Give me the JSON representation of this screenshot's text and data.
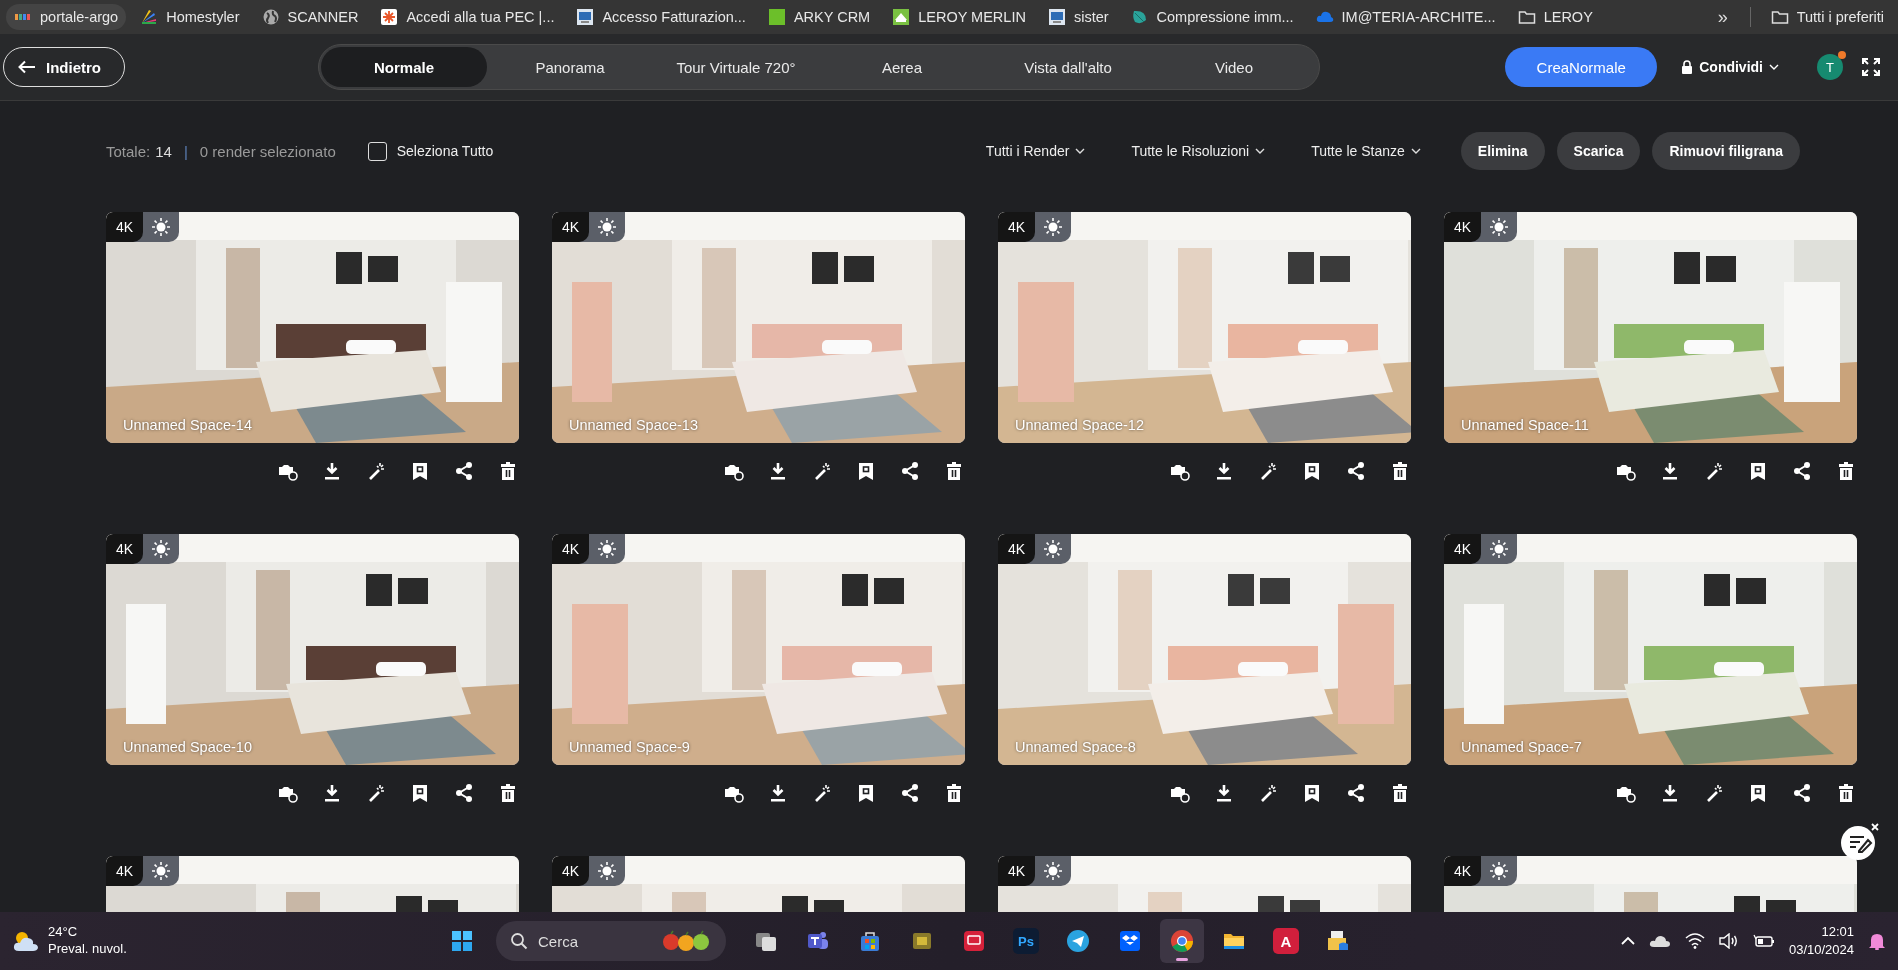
{
  "bookmarks": [
    {
      "label": "portale-argo",
      "kind": "bars"
    },
    {
      "label": "Homestyler",
      "kind": "fan"
    },
    {
      "label": "SCANNER",
      "kind": "globe"
    },
    {
      "label": "Accedi alla tua PEC |...",
      "kind": "star"
    },
    {
      "label": "Accesso Fatturazion...",
      "kind": "doc"
    },
    {
      "label": "ARKY CRM",
      "kind": "square"
    },
    {
      "label": "LEROY MERLIN",
      "kind": "house"
    },
    {
      "label": "sister",
      "kind": "doc"
    },
    {
      "label": "Compressione imm...",
      "kind": "leaf"
    },
    {
      "label": "IM@TERIA-ARCHITE...",
      "kind": "cloud"
    },
    {
      "label": "LEROY",
      "kind": "folder"
    }
  ],
  "bookmarks_more": "»",
  "all_bookmarks": "Tutti i preferiti",
  "header": {
    "back": "Indietro",
    "tabs": [
      {
        "label": "Normale",
        "selected": true
      },
      {
        "label": "Panorama",
        "selected": false
      },
      {
        "label": "Tour Virtuale 720°",
        "selected": false
      },
      {
        "label": "Aerea",
        "selected": false
      },
      {
        "label": "Vista dall'alto",
        "selected": false
      },
      {
        "label": "Video",
        "selected": false
      }
    ],
    "create": "CreaNormale",
    "share": "Condividi",
    "avatar": "T",
    "notification": true
  },
  "toolbar": {
    "total_label": "Totale:",
    "total": "14",
    "separator": "|",
    "selected_count": "0 render selezionato",
    "select_all": {
      "label": "Seleziona Tutto",
      "checked": false
    },
    "filters": [
      "Tutti i Render",
      "Tutte le Risoluzioni",
      "Tutte le Stanze"
    ],
    "actions": [
      "Elimina",
      "Scarica",
      "Rimuovi filigrana"
    ]
  },
  "renders": [
    {
      "resolution": "4K",
      "name": "Unnamed Space-14"
    },
    {
      "resolution": "4K",
      "name": "Unnamed Space-13"
    },
    {
      "resolution": "4K",
      "name": "Unnamed Space-12"
    },
    {
      "resolution": "4K",
      "name": "Unnamed Space-11"
    },
    {
      "resolution": "4K",
      "name": "Unnamed Space-10"
    },
    {
      "resolution": "4K",
      "name": "Unnamed Space-9"
    },
    {
      "resolution": "4K",
      "name": "Unnamed Space-8"
    },
    {
      "resolution": "4K",
      "name": "Unnamed Space-7"
    },
    {
      "resolution": "4K"
    },
    {
      "resolution": "4K"
    },
    {
      "resolution": "4K"
    },
    {
      "resolution": "4K"
    }
  ],
  "taskbar": {
    "weather": {
      "temp": "24°C",
      "desc": "Preval. nuvol."
    },
    "search": "Cerca",
    "apps": [
      {
        "kind": "windows",
        "active": false
      },
      {
        "kind": "tasks",
        "active": false
      },
      {
        "kind": "teams",
        "active": false
      },
      {
        "kind": "store",
        "active": false
      },
      {
        "kind": "card",
        "active": false
      },
      {
        "kind": "remote",
        "active": false
      },
      {
        "kind": "ps",
        "label": "Ps",
        "active": false
      },
      {
        "kind": "telegram",
        "active": false
      },
      {
        "kind": "dropbox",
        "active": false
      },
      {
        "kind": "chrome",
        "active": true
      },
      {
        "kind": "explorer",
        "active": false
      },
      {
        "kind": "autocad",
        "label": "A",
        "active": false
      },
      {
        "kind": "docfolder",
        "active": false
      }
    ],
    "time": "12:01",
    "date": "03/10/2024"
  }
}
